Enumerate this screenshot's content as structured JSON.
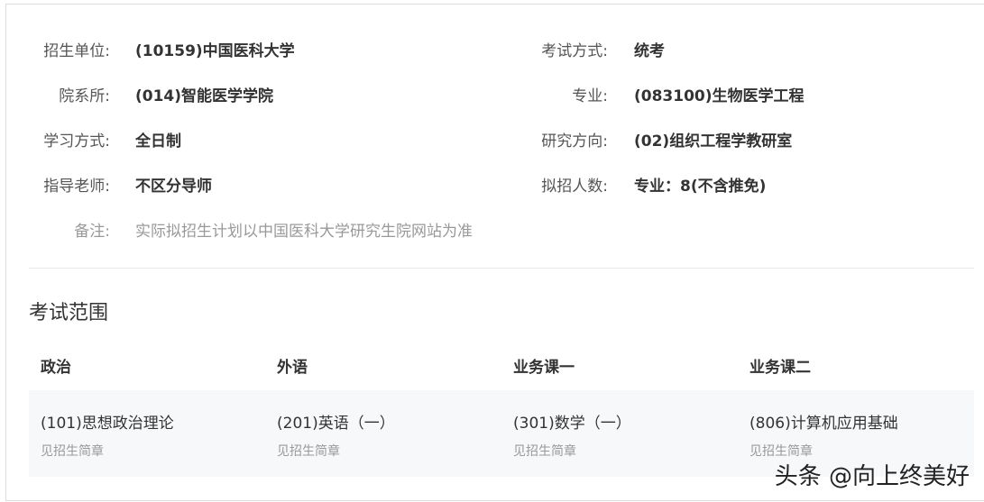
{
  "info": [
    {
      "label": "招生单位:",
      "value": "(10159)中国医科大学"
    },
    {
      "label": "考试方式:",
      "value": "统考"
    },
    {
      "label": "院系所:",
      "value": "(014)智能医学学院"
    },
    {
      "label": "专业:",
      "value": "(083100)生物医学工程"
    },
    {
      "label": "学习方式:",
      "value": "全日制"
    },
    {
      "label": "研究方向:",
      "value": "(02)组织工程学教研室"
    },
    {
      "label": "指导老师:",
      "value": "不区分导师"
    },
    {
      "label": "拟招人数:",
      "value": "专业：8(不含推免)"
    },
    {
      "label": "备注:",
      "value": "实际拟招生计划以中国医科大学研究生院网站为准"
    }
  ],
  "section_title": "考试范围",
  "exam": {
    "headers": [
      "政治",
      "外语",
      "业务课一",
      "业务课二"
    ],
    "courses": [
      "(101)思想政治理论",
      "(201)英语（一）",
      "(301)数学（一）",
      "(806)计算机应用基础"
    ],
    "notes": [
      "见招生简章",
      "见招生简章",
      "见招生简章",
      "见招生简章"
    ]
  },
  "watermark": "头条 @向上终美好"
}
